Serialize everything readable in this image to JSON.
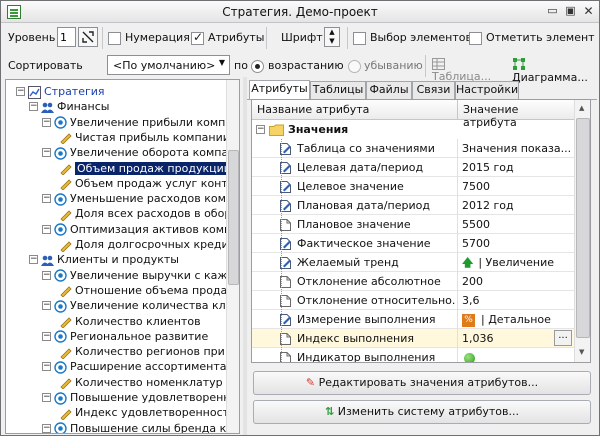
{
  "window": {
    "title": "Стратегия. Демо-проект"
  },
  "toolbar": {
    "level_label": "Уровень",
    "level_value": "1",
    "numbering_label": "Нумерация",
    "numbering_checked": false,
    "attributes_label": "Атрибуты",
    "attributes_checked": true,
    "font_label": "Шрифт",
    "select_elements_label": "Выбор элементов",
    "select_elements_checked": false,
    "mark_element_label": "Отметить элемент",
    "mark_element_checked": false
  },
  "sortbar": {
    "sort_label": "Сортировать",
    "sort_value": "<По умолчанию>",
    "by_label": "по",
    "asc_label": "возрастанию",
    "desc_label": "убыванию",
    "order": "asc",
    "table_label": "Таблица...",
    "diagram_label": "Диаграмма..."
  },
  "tree": {
    "items": [
      {
        "label": "Стратегия",
        "type": "root"
      },
      {
        "label": "Финансы",
        "type": "group"
      },
      {
        "label": "Увеличение прибыли компан",
        "type": "goal"
      },
      {
        "label": "Чистая прибыль компании",
        "type": "indicator"
      },
      {
        "label": "Увеличение оборота компан",
        "type": "goal"
      },
      {
        "label": "Объем продаж продукции",
        "type": "indicator",
        "selected": true
      },
      {
        "label": "Объем продаж услуг контр",
        "type": "indicator"
      },
      {
        "label": "Уменьшение расходов компа",
        "type": "goal"
      },
      {
        "label": "Доля всех расходов в обор",
        "type": "indicator"
      },
      {
        "label": "Оптимизация активов компа",
        "type": "goal"
      },
      {
        "label": "Доля долгосрочных кредит",
        "type": "indicator"
      },
      {
        "label": "Клиенты и продукты",
        "type": "group"
      },
      {
        "label": "Увеличение выручки с кажд",
        "type": "goal"
      },
      {
        "label": "Отношение объема прода",
        "type": "indicator"
      },
      {
        "label": "Увеличение количества кли",
        "type": "goal"
      },
      {
        "label": "Количество клиентов",
        "type": "indicator"
      },
      {
        "label": "Региональное развитие",
        "type": "goal"
      },
      {
        "label": "Количество регионов при",
        "type": "indicator"
      },
      {
        "label": "Расширение ассортимента",
        "type": "goal"
      },
      {
        "label": "Количество номенклатур",
        "type": "indicator"
      },
      {
        "label": "Повышение удовлетворенно",
        "type": "goal"
      },
      {
        "label": "Индекс удовлетворенност",
        "type": "indicator"
      },
      {
        "label": "Повышение силы бренда ком",
        "type": "goal"
      }
    ]
  },
  "tabs": [
    {
      "label": "Атрибуты",
      "active": true
    },
    {
      "label": "Таблицы",
      "active": false
    },
    {
      "label": "Файлы",
      "active": false
    },
    {
      "label": "Связи",
      "active": false
    },
    {
      "label": "Настройки",
      "active": false
    }
  ],
  "attributes": {
    "header": {
      "name": "Название атрибута",
      "value": "Значение атрибута"
    },
    "group": "Значения",
    "rows": [
      {
        "name": "Таблица со значениями",
        "value": "Значения показа...",
        "icon": "edit-icon"
      },
      {
        "name": "Целевая дата/период",
        "value": "2015 год",
        "icon": "edit-icon"
      },
      {
        "name": "Целевое значение",
        "value": "7500",
        "icon": "edit-icon"
      },
      {
        "name": "Плановая дата/период",
        "value": "2012 год",
        "icon": "edit-icon"
      },
      {
        "name": "Плановое значение",
        "value": "5500",
        "icon": "doc-icon"
      },
      {
        "name": "Фактическое значение",
        "value": "5700",
        "icon": "edit-icon"
      },
      {
        "name": "Желаемый тренд",
        "value": "| Увеличение",
        "icon": "edit-icon",
        "value_icon": "arrow-up-icon"
      },
      {
        "name": "Отклонение абсолютное",
        "value": "200",
        "icon": "doc-icon"
      },
      {
        "name": "Отклонение относительно...",
        "value": "3,6",
        "icon": "doc-icon"
      },
      {
        "name": "Измерение выполнения",
        "value": "| Детальное",
        "icon": "edit-icon",
        "value_icon": "percent-icon"
      },
      {
        "name": "Индекс выполнения",
        "value": "1,036",
        "icon": "doc-icon",
        "highlight": true
      },
      {
        "name": "Индикатор выполнения",
        "value": "",
        "icon": "doc-icon",
        "value_icon": "green-circle-icon"
      }
    ]
  },
  "buttons": {
    "edit_values": "Редактировать значения атрибутов...",
    "change_system": "Изменить систему атрибутов..."
  },
  "colors": {
    "selection": "#0a246a",
    "highlight_row": "#fff8dc",
    "tree_link": "#1a3fa8"
  }
}
